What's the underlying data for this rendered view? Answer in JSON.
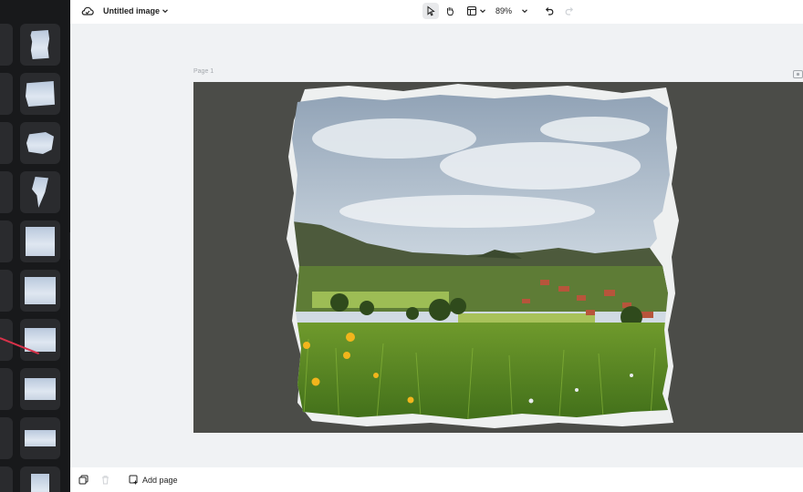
{
  "document": {
    "title": "Untitled image"
  },
  "toolbar": {
    "zoom": "89%"
  },
  "canvas": {
    "page_label": "Page 1"
  },
  "bottom": {
    "add_page_label": "Add page"
  },
  "colors": {
    "page_background": "#4b4c48",
    "panel_background": "#18191b",
    "accent_red": "#d8324a"
  }
}
